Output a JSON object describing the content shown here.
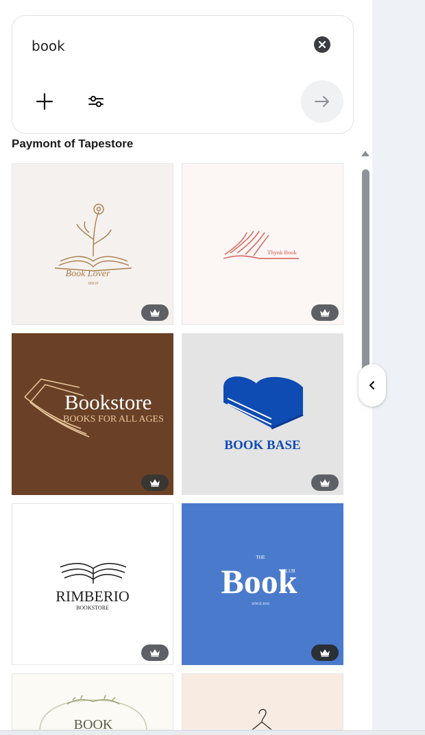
{
  "search": {
    "query": "book"
  },
  "section": {
    "heading": "Paymont of Tapestore"
  },
  "colors": {
    "accent_blue": "#0e4bb3",
    "brown": "#6a4127",
    "club_blue": "#4a7acb"
  },
  "results": [
    {
      "title": "Book Lover",
      "subtitle": "SHOP",
      "icon": "crown-icon"
    },
    {
      "title": "Thynk Book",
      "icon": "crown-icon"
    },
    {
      "title": "Bookstore",
      "subtitle": "BOOKS FOR ALL AGES",
      "icon": "crown-icon"
    },
    {
      "title": "BOOK BASE",
      "icon": "crown-icon"
    },
    {
      "title": "RIMBERIO",
      "subtitle": "BOOKSTORE",
      "icon": "crown-icon"
    },
    {
      "title": "Book",
      "prefix": "THE",
      "suffix": "CLUB",
      "subtitle": "SINCE 2016",
      "icon": "crown-icon"
    },
    {
      "title": "BOOK"
    },
    {
      "title": ""
    }
  ]
}
